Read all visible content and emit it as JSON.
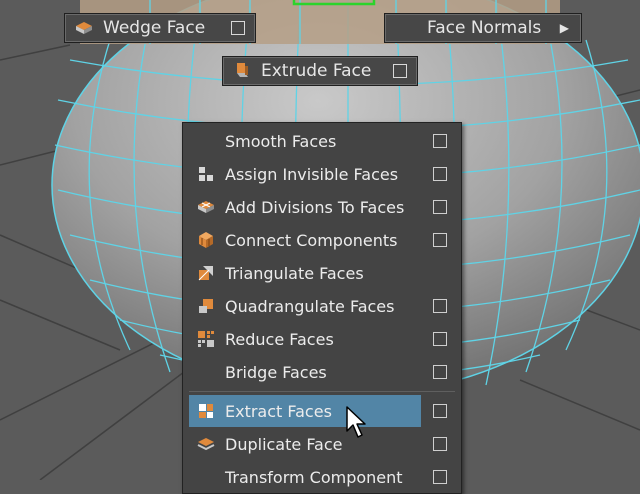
{
  "buttons": {
    "wedge_face": "Wedge Face",
    "face_normals": "Face Normals",
    "extrude_face": "Extrude Face"
  },
  "menu": {
    "items": [
      {
        "label": "Smooth Faces",
        "icon": "none",
        "has_option_box": true
      },
      {
        "label": "Assign Invisible Faces",
        "icon": "invisible-faces-icon",
        "has_option_box": true
      },
      {
        "label": "Add Divisions To Faces",
        "icon": "add-divisions-icon",
        "has_option_box": true
      },
      {
        "label": "Connect Components",
        "icon": "connect-components-icon",
        "has_option_box": true
      },
      {
        "label": "Triangulate Faces",
        "icon": "triangulate-icon",
        "has_option_box": false
      },
      {
        "label": "Quadrangulate Faces",
        "icon": "quadrangulate-icon",
        "has_option_box": true
      },
      {
        "label": "Reduce Faces",
        "icon": "reduce-faces-icon",
        "has_option_box": true
      },
      {
        "label": "Bridge Faces",
        "icon": "none",
        "has_option_box": true
      },
      {
        "label": "Extract Faces",
        "icon": "extract-faces-icon",
        "has_option_box": true,
        "highlighted": true
      },
      {
        "label": "Duplicate Face",
        "icon": "duplicate-face-icon",
        "has_option_box": true
      },
      {
        "label": "Transform Component",
        "icon": "none",
        "has_option_box": true
      }
    ]
  },
  "colors": {
    "viewport_bg": "#5b5b5b",
    "wireframe": "#5fd3e6",
    "highlight": "#5285a6",
    "icon_orange": "#e08a3c",
    "selection_green": "#2bd42b"
  }
}
